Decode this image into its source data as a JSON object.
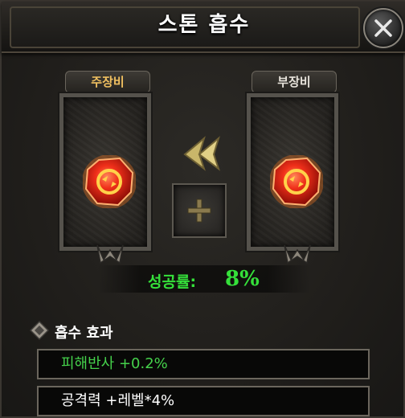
{
  "dialog": {
    "title": "스톤 흡수",
    "close_icon": "close-x-icon"
  },
  "slots": {
    "main_label": "주장비",
    "sub_label": "부장비",
    "main_item_icon": "red-gem-icon",
    "sub_item_icon": "red-gem-icon"
  },
  "merge": {
    "arrow_icon": "double-left-arrow-icon",
    "plus_icon": "plus-icon"
  },
  "success": {
    "label": "성공률:",
    "value": "8%"
  },
  "effects": {
    "title": "흡수 효과",
    "items": [
      {
        "text": "피해반사 +0.2%",
        "color": "#45d14b"
      },
      {
        "text": "공격력 +레벨*4%",
        "color": "#ffffff"
      }
    ]
  }
}
